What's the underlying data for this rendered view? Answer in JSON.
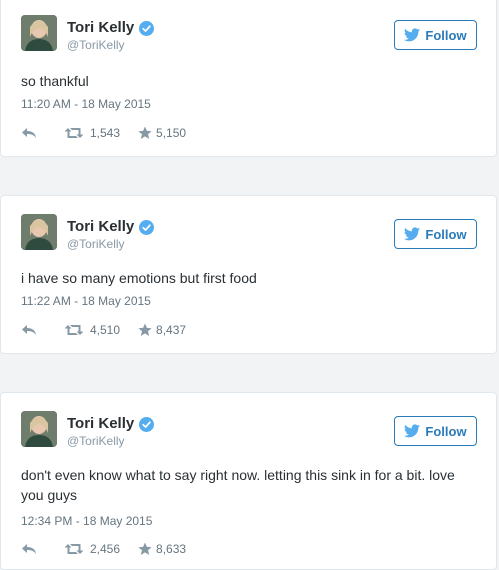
{
  "colors": {
    "accent": "#2b7bb9",
    "verified": "#55acee",
    "muted": "#8899a6"
  },
  "tweets": [
    {
      "name": "Tori Kelly",
      "handle": "@ToriKelly",
      "follow_label": "Follow",
      "text": "so thankful",
      "timestamp": "11:20 AM - 18 May 2015",
      "retweets": "1,543",
      "favorites": "5,150"
    },
    {
      "name": "Tori Kelly",
      "handle": "@ToriKelly",
      "follow_label": "Follow",
      "text": "i have so many emotions but first food",
      "timestamp": "11:22 AM - 18 May 2015",
      "retweets": "4,510",
      "favorites": "8,437"
    },
    {
      "name": "Tori Kelly",
      "handle": "@ToriKelly",
      "follow_label": "Follow",
      "text": "don't even know what to say right now. letting this sink in for a bit. love you guys",
      "timestamp": "12:34 PM - 18 May 2015",
      "retweets": "2,456",
      "favorites": "8,633"
    }
  ],
  "icons": [
    "avatar",
    "verified-badge-icon",
    "twitter-bird-icon",
    "reply-icon",
    "retweet-icon",
    "favorite-star-icon"
  ]
}
